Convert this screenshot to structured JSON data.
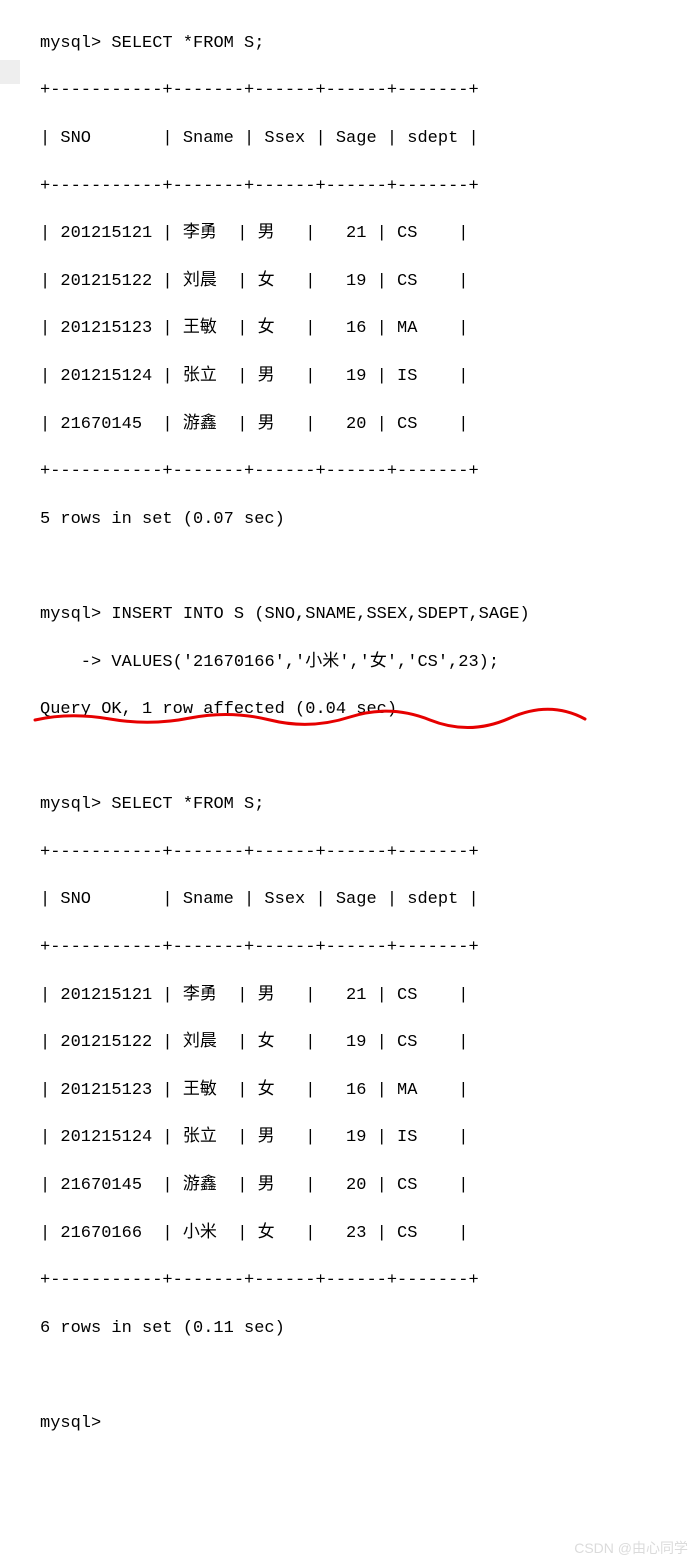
{
  "prompt": "mysql>",
  "continuation_prompt": "    ->",
  "query1": {
    "command": "SELECT *FROM S;",
    "border_top": "+-----------+-------+------+------+-------+",
    "header_line": "| SNO       | Sname | Ssex | Sage | sdept |",
    "border_mid": "+-----------+-------+------+------+-------+",
    "rows": [
      "| 201215121 | 李勇  | 男   |   21 | CS    |",
      "| 201215122 | 刘晨  | 女   |   19 | CS    |",
      "| 201215123 | 王敏  | 女   |   16 | MA    |",
      "| 201215124 | 张立  | 男   |   19 | IS    |",
      "| 21670145  | 游鑫  | 男   |   20 | CS    |"
    ],
    "border_bot": "+-----------+-------+------+------+-------+",
    "result": "5 rows in set (0.07 sec)"
  },
  "insert": {
    "line1": "INSERT INTO S (SNO,SNAME,SSEX,SDEPT,SAGE)",
    "line2": "VALUES('21670166','小米','女','CS',23);",
    "result": "Query OK, 1 row affected (0.04 sec)"
  },
  "query2": {
    "command": "SELECT *FROM S;",
    "border_top": "+-----------+-------+------+------+-------+",
    "header_line": "| SNO       | Sname | Ssex | Sage | sdept |",
    "border_mid": "+-----------+-------+------+------+-------+",
    "rows": [
      "| 201215121 | 李勇  | 男   |   21 | CS    |",
      "| 201215122 | 刘晨  | 女   |   19 | CS    |",
      "| 201215123 | 王敏  | 女   |   16 | MA    |",
      "| 201215124 | 张立  | 男   |   19 | IS    |",
      "| 21670145  | 游鑫  | 男   |   20 | CS    |",
      "| 21670166  | 小米  | 女   |   23 | CS    |"
    ],
    "border_bot": "+-----------+-------+------+------+-------+",
    "result": "6 rows in set (0.11 sec)"
  },
  "watermark": "CSDN @由心同学",
  "chart_data": {
    "type": "table",
    "title": "S table contents before and after INSERT",
    "columns": [
      "SNO",
      "Sname",
      "Ssex",
      "Sage",
      "sdept"
    ],
    "before_insert": [
      {
        "SNO": "201215121",
        "Sname": "李勇",
        "Ssex": "男",
        "Sage": 21,
        "sdept": "CS"
      },
      {
        "SNO": "201215122",
        "Sname": "刘晨",
        "Ssex": "女",
        "Sage": 19,
        "sdept": "CS"
      },
      {
        "SNO": "201215123",
        "Sname": "王敏",
        "Ssex": "女",
        "Sage": 16,
        "sdept": "MA"
      },
      {
        "SNO": "201215124",
        "Sname": "张立",
        "Ssex": "男",
        "Sage": 19,
        "sdept": "IS"
      },
      {
        "SNO": "21670145",
        "Sname": "游鑫",
        "Ssex": "男",
        "Sage": 20,
        "sdept": "CS"
      }
    ],
    "after_insert": [
      {
        "SNO": "201215121",
        "Sname": "李勇",
        "Ssex": "男",
        "Sage": 21,
        "sdept": "CS"
      },
      {
        "SNO": "201215122",
        "Sname": "刘晨",
        "Ssex": "女",
        "Sage": 19,
        "sdept": "CS"
      },
      {
        "SNO": "201215123",
        "Sname": "王敏",
        "Ssex": "女",
        "Sage": 16,
        "sdept": "MA"
      },
      {
        "SNO": "201215124",
        "Sname": "张立",
        "Ssex": "男",
        "Sage": 19,
        "sdept": "IS"
      },
      {
        "SNO": "21670145",
        "Sname": "游鑫",
        "Ssex": "男",
        "Sage": 20,
        "sdept": "CS"
      },
      {
        "SNO": "21670166",
        "Sname": "小米",
        "Ssex": "女",
        "Sage": 23,
        "sdept": "CS"
      }
    ],
    "insert_statement": "INSERT INTO S (SNO,SNAME,SSEX,SDEPT,SAGE) VALUES('21670166','小米','女','CS',23);"
  }
}
